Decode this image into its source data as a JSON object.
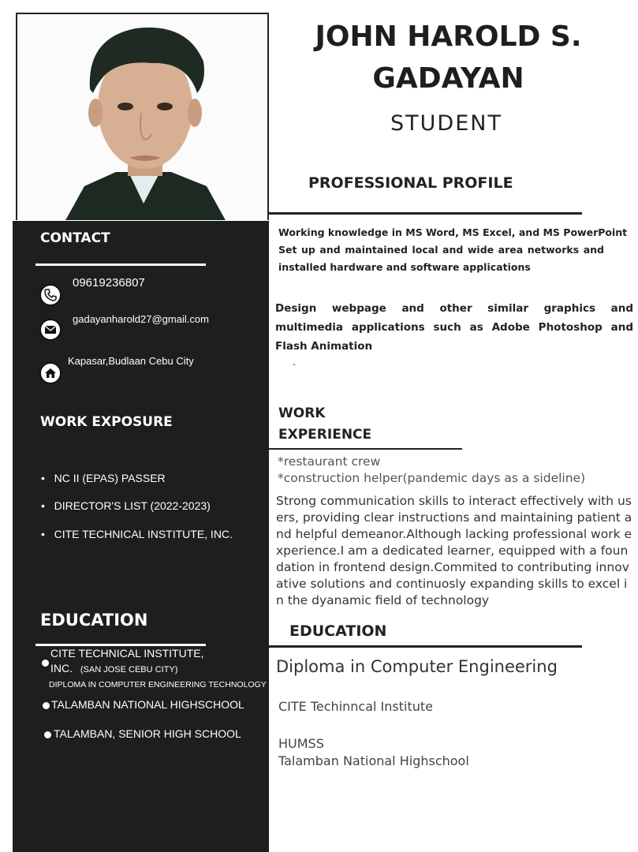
{
  "header": {
    "name_line1": "JOHN HAROLD S.",
    "name_line2": "GADAYAN",
    "role": "STUDENT"
  },
  "contact": {
    "heading": "CONTACT",
    "phone": "09619236807",
    "email": "gadayanharold27@gmail.com",
    "address": "Kapasar,Budlaan Cebu City"
  },
  "work_exposure": {
    "heading": "WORK EXPOSURE",
    "items": [
      "NC II (EPAS) PASSER",
      "DIRECTOR'S LIST (2022-2023)",
      "CITE TECHNICAL INSTITUTE, INC."
    ]
  },
  "side_education": {
    "heading": "EDUCATION",
    "item1_line1": "CITE TECHNICAL INSTITUTE,",
    "item1_line2": "INC.",
    "item1_location": "(SAN JOSE CEBU CITY)",
    "item1_program": "DIPLOMA IN COMPUTER ENGINEERING TECHNOLOGY",
    "item2": "TALAMBAN NATIONAL HIGHSCHOOL",
    "item3": "TALAMBAN, SENIOR HIGH SCHOOL"
  },
  "profile": {
    "heading": "PROFESSIONAL PROFILE",
    "line1": "Working knowledge in MS Word, MS Excel, and MS PowerPoint",
    "para2": "Set up and maintained local and wide area networks and installed hardware and software applications",
    "para3": "Design webpage and other similar graphics and multimedia applications such as Adobe Photoshop and Flash Animation",
    "stray_mark": "-"
  },
  "work_experience": {
    "heading_line1": "WORK",
    "heading_line2": "EXPERIENCE",
    "item1": "*restaurant crew",
    "item2": "*construction helper(pandemic days as a sideline)",
    "summary": "Strong communication skills to interact effectively with users, providing clear instructions and maintaining patient and helpful demeanor.Although lacking professional work experience.I am a dedicated learner, equipped with a foundation in frontend design.Commited to contributing innovative solutions and continuosly expanding skills to excel in the dyanamic field of technology"
  },
  "education": {
    "heading": "EDUCATION",
    "degree": "Diploma in Computer Engineering",
    "school1": "CITE Techinncal Institute",
    "strand": "HUMSS",
    "school2": "Talamban National Highschool"
  }
}
